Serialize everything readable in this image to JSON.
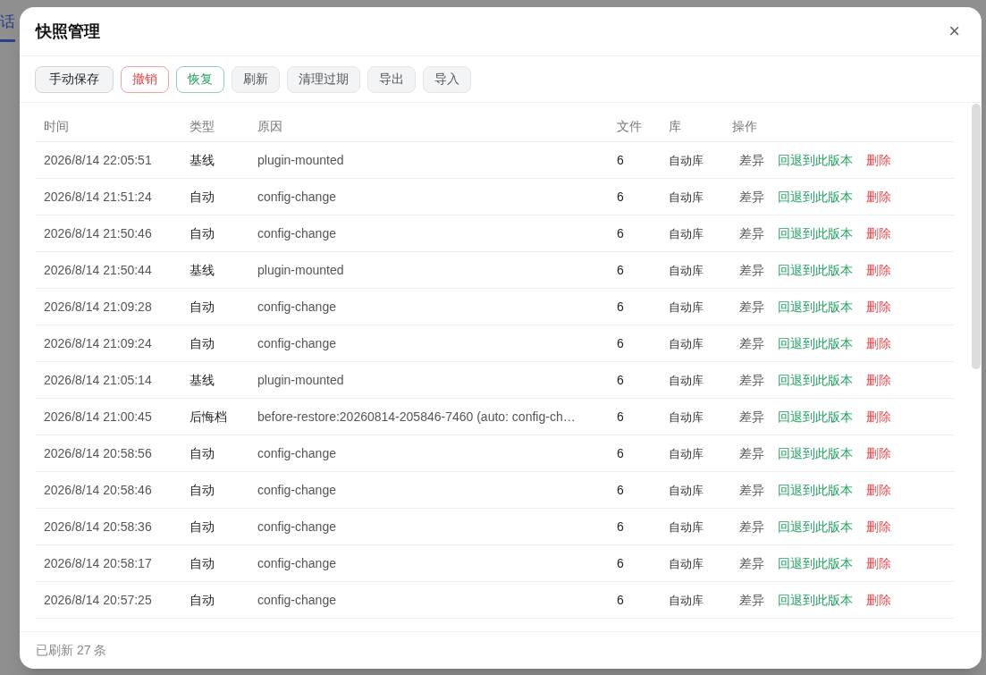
{
  "background": {
    "tab": {
      "label": "话",
      "selected": true
    }
  },
  "dialog": {
    "title": "快照管理",
    "close": "×",
    "toolbar": [
      {
        "label": "手动保存",
        "kind": "default"
      },
      {
        "label": "撤销",
        "kind": "danger"
      },
      {
        "label": "恢复",
        "kind": "success"
      },
      {
        "label": "刷新",
        "kind": "plain"
      },
      {
        "label": "清理过期",
        "kind": "plain"
      },
      {
        "label": "导出",
        "kind": "plain"
      },
      {
        "label": "导入",
        "kind": "plain"
      }
    ],
    "table": {
      "columns": [
        "时间",
        "类型",
        "原因",
        "文件",
        "库",
        "操作"
      ],
      "rows": [
        {
          "time": "2026/8/14 22:05:51",
          "type": "基线",
          "reason": "plugin-mounted",
          "files": "6",
          "library": "自动库",
          "actions": [
            "差异",
            "回退到此版本",
            "删除"
          ]
        },
        {
          "time": "2026/8/14 21:51:24",
          "type": "自动",
          "reason": "config-change",
          "files": "6",
          "library": "自动库",
          "actions": [
            "差异",
            "回退到此版本",
            "删除"
          ]
        },
        {
          "time": "2026/8/14 21:50:46",
          "type": "自动",
          "reason": "config-change",
          "files": "6",
          "library": "自动库",
          "actions": [
            "差异",
            "回退到此版本",
            "删除"
          ]
        },
        {
          "time": "2026/8/14 21:50:44",
          "type": "基线",
          "reason": "plugin-mounted",
          "files": "6",
          "library": "自动库",
          "actions": [
            "差异",
            "回退到此版本",
            "删除"
          ]
        },
        {
          "time": "2026/8/14 21:09:28",
          "type": "自动",
          "reason": "config-change",
          "files": "6",
          "library": "自动库",
          "actions": [
            "差异",
            "回退到此版本",
            "删除"
          ]
        },
        {
          "time": "2026/8/14 21:09:24",
          "type": "自动",
          "reason": "config-change",
          "files": "6",
          "library": "自动库",
          "actions": [
            "差异",
            "回退到此版本",
            "删除"
          ]
        },
        {
          "time": "2026/8/14 21:05:14",
          "type": "基线",
          "reason": "plugin-mounted",
          "files": "6",
          "library": "自动库",
          "actions": [
            "差异",
            "回退到此版本",
            "删除"
          ]
        },
        {
          "time": "2026/8/14 21:00:45",
          "type": "后悔档",
          "reason": "before-restore:20260814-205846-7460 (auto: config-ch…",
          "files": "6",
          "library": "自动库",
          "actions": [
            "差异",
            "回退到此版本",
            "删除"
          ]
        },
        {
          "time": "2026/8/14 20:58:56",
          "type": "自动",
          "reason": "config-change",
          "files": "6",
          "library": "自动库",
          "actions": [
            "差异",
            "回退到此版本",
            "删除"
          ]
        },
        {
          "time": "2026/8/14 20:58:46",
          "type": "自动",
          "reason": "config-change",
          "files": "6",
          "library": "自动库",
          "actions": [
            "差异",
            "回退到此版本",
            "删除"
          ]
        },
        {
          "time": "2026/8/14 20:58:36",
          "type": "自动",
          "reason": "config-change",
          "files": "6",
          "library": "自动库",
          "actions": [
            "差异",
            "回退到此版本",
            "删除"
          ]
        },
        {
          "time": "2026/8/14 20:58:17",
          "type": "自动",
          "reason": "config-change",
          "files": "6",
          "library": "自动库",
          "actions": [
            "差异",
            "回退到此版本",
            "删除"
          ]
        },
        {
          "time": "2026/8/14 20:57:25",
          "type": "自动",
          "reason": "config-change",
          "files": "6",
          "library": "自动库",
          "actions": [
            "差异",
            "回退到此版本",
            "删除"
          ]
        }
      ]
    },
    "status": "已刷新 27 条"
  }
}
